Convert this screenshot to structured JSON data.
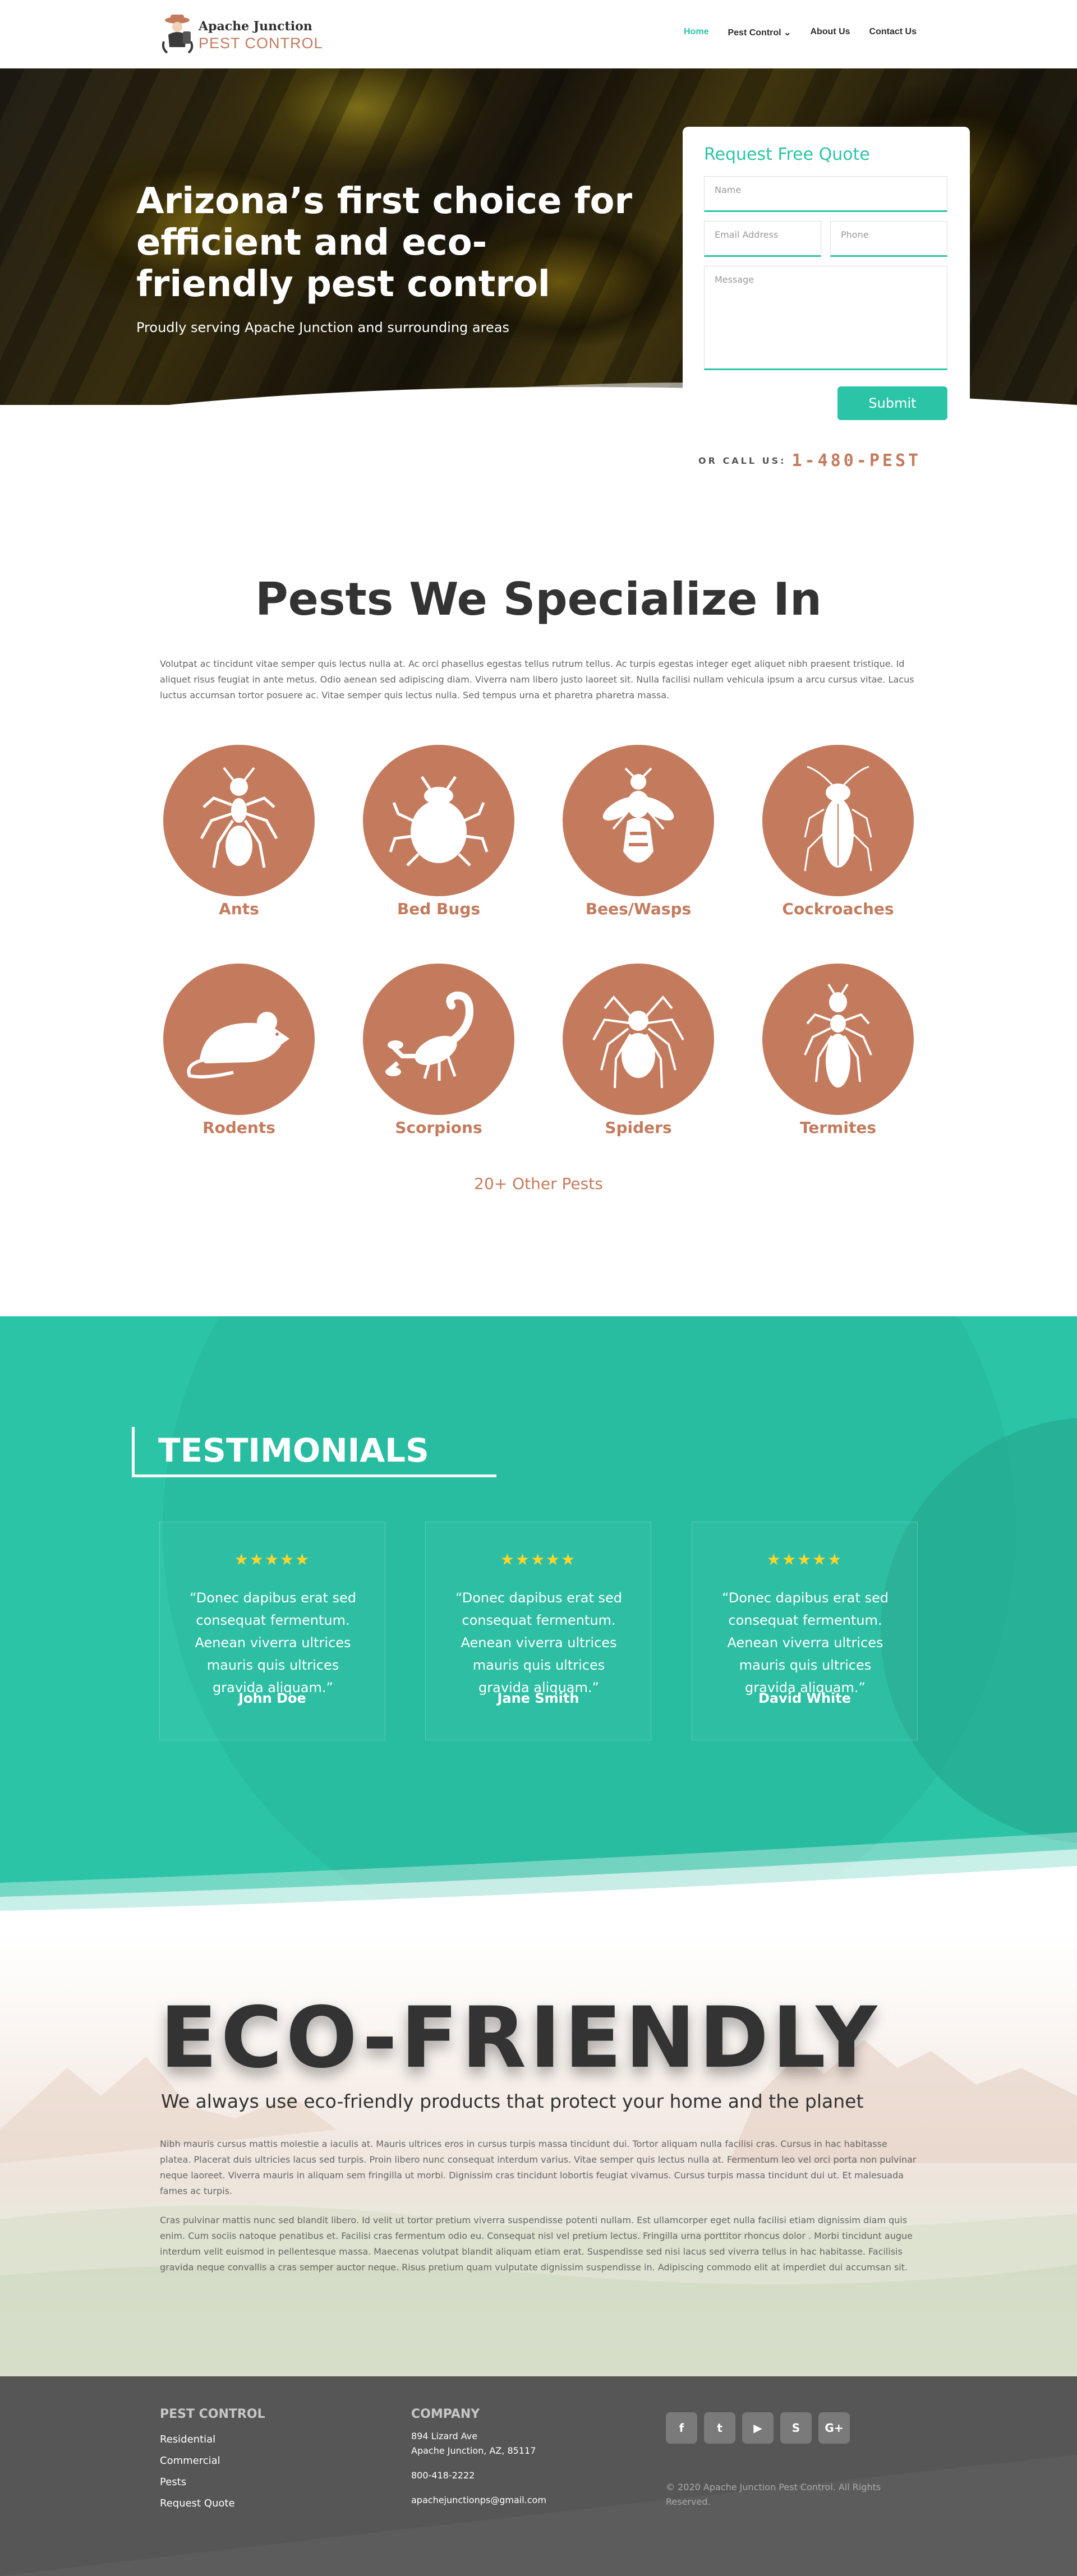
{
  "header": {
    "logo_line1": "Apache Junction",
    "logo_line2": "PEST CONTROL",
    "nav": [
      {
        "label": "Home"
      },
      {
        "label": "Pest Control ⌄"
      },
      {
        "label": "About Us"
      },
      {
        "label": "Contact Us"
      }
    ]
  },
  "hero": {
    "title": "Arizona’s first choice for efficient and eco-friendly pest control",
    "subtitle": "Proudly serving Apache Junction and surrounding areas"
  },
  "quote_form": {
    "title": "Request Free Quote",
    "name_placeholder": "Name",
    "email_placeholder": "Email Address",
    "phone_placeholder": "Phone",
    "message_placeholder": "Message",
    "submit_label": "Submit"
  },
  "callus": {
    "label": "OR CALL US:",
    "phone": "1-480-PEST"
  },
  "pests": {
    "title": "Pests We Specialize In",
    "description": "Volutpat ac tincidunt vitae semper quis lectus nulla at. Ac orci phasellus egestas tellus rutrum tellus. Ac turpis egestas integer eget aliquet nibh praesent tristique. Id aliquet risus feugiat in ante metus. Odio aenean sed adipiscing diam. Viverra nam libero justo laoreet sit. Nulla facilisi nullam vehicula ipsum a arcu cursus vitae. Lacus luctus accumsan tortor posuere ac. Vitae semper quis lectus nulla. Sed tempus urna et pharetra pharetra massa.",
    "items": [
      {
        "label": "Ants"
      },
      {
        "label": "Bed Bugs"
      },
      {
        "label": "Bees/Wasps"
      },
      {
        "label": "Cockroaches"
      },
      {
        "label": "Rodents"
      },
      {
        "label": "Scorpions"
      },
      {
        "label": "Spiders"
      },
      {
        "label": "Termites"
      }
    ],
    "other_link": "20+ Other Pests",
    "accent_color": "#c47b5d"
  },
  "testimonials": {
    "heading": "TESTIMONIALS",
    "stars": "★★★★★",
    "items": [
      {
        "quote": "“Donec dapibus erat sed consequat fermentum. Aenean viverra ultrices mauris quis ultrices gravida aliquam.”",
        "name": "John Doe"
      },
      {
        "quote": "“Donec dapibus erat sed consequat fermentum. Aenean viverra ultrices mauris quis ultrices gravida aliquam.”",
        "name": "Jane Smith"
      },
      {
        "quote": "“Donec dapibus erat sed consequat fermentum. Aenean viverra ultrices mauris quis ultrices gravida aliquam.”",
        "name": "David White"
      }
    ],
    "bg_color": "#2cc4a7"
  },
  "eco": {
    "title": "ECO-FRIENDLY",
    "subtitle": "We always use eco-friendly products that protect your home and the planet",
    "paragraph1": "Nibh mauris cursus mattis molestie a iaculis at. Mauris ultrices eros in cursus turpis massa tincidunt dui. Tortor aliquam nulla facilisi cras. Cursus in hac habitasse platea. Placerat duis ultricies lacus sed turpis. Proin libero nunc consequat interdum varius. Vitae semper quis lectus nulla at. Fermentum leo vel orci porta non pulvinar neque laoreet. Viverra mauris in aliquam sem fringilla ut morbi. Dignissim cras tincidunt lobortis feugiat vivamus. Cursus turpis massa tincidunt dui ut. Et malesuada fames ac turpis.",
    "paragraph2": "Cras pulvinar mattis nunc sed blandit libero. Id velit ut tortor pretium viverra suspendisse potenti nullam. Est ullamcorper eget nulla facilisi etiam dignissim diam quis enim. Cum sociis natoque penatibus et. Facilisi cras fermentum odio eu. Consequat nisl vel pretium lectus. Fringilla urna porttitor rhoncus dolor . Morbi tincidunt augue interdum velit euismod in pellentesque massa. Maecenas volutpat blandit aliquam etiam erat. Suspendisse sed nisi lacus sed viverra tellus in hac habitasse. Facilisis gravida neque convallis a cras semper auctor neque. Risus pretium quam vulputate dignissim suspendisse in. Adipiscing commodo elit at imperdiet dui accumsan sit."
  },
  "footer": {
    "col1_head": "PEST CONTROL",
    "col1_links": [
      {
        "label": "Residential"
      },
      {
        "label": "Commercial"
      },
      {
        "label": "Pests"
      },
      {
        "label": "Request Quote"
      }
    ],
    "col2_head": "COMPANY",
    "address_line1": "894 Lizard Ave",
    "address_line2": "Apache Junction, AZ, 85117",
    "phone": "800-418-2222",
    "email": "apachejunctionps@gmail.com",
    "social": [
      {
        "icon": "facebook-icon",
        "glyph": "f"
      },
      {
        "icon": "twitter-icon",
        "glyph": "t"
      },
      {
        "icon": "youtube-icon",
        "glyph": "▶"
      },
      {
        "icon": "skype-icon",
        "glyph": "S"
      },
      {
        "icon": "google-plus-icon",
        "glyph": "G+"
      }
    ],
    "copyright": "© 2020 Apache Junction Pest Control. All Rights Reserved."
  }
}
